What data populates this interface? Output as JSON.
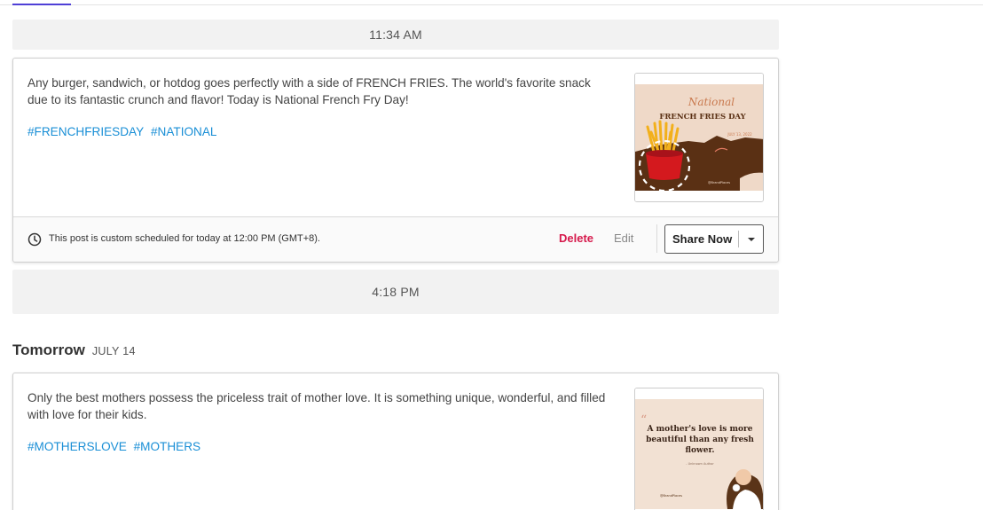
{
  "time_slots": [
    "11:34 AM",
    "4:18 PM"
  ],
  "today_post": {
    "text": "Any burger, sandwich, or hotdog goes perfectly with a side of FRENCH FRIES. The world's favorite snack due to its fantastic crunch and flavor! Today is National French Fry Day!",
    "tags": [
      "#FRENCHFRIESDAY",
      "#NATIONAL"
    ],
    "thumbnail": {
      "script_title": "National",
      "title": "FRENCH FRIES DAY",
      "date": "JULY 13, 2022",
      "handle": "@BrandPlaces",
      "colors": {
        "background": "#efd9c8",
        "band": "#5a3014",
        "box": "#d4191e",
        "fries": "#f2b01c"
      }
    },
    "footer": {
      "schedule_text": "This post is custom scheduled for today at 12:00 PM (GMT+8).",
      "delete_label": "Delete",
      "edit_label": "Edit",
      "share_label": "Share Now"
    }
  },
  "day_header": {
    "name": "Tomorrow",
    "date": "JULY 14"
  },
  "tomorrow_post": {
    "text": "Only the best mothers possess the priceless trait of mother love. It is something unique, wonderful, and filled with love for their kids.",
    "tags": [
      "#MOTHERSLOVE",
      "#MOTHERS"
    ],
    "thumbnail": {
      "quote": [
        "A mother's love is more",
        "beautiful than any fresh",
        "flower."
      ],
      "attribution": "- Unknown Author",
      "handle": "@BrandPlaces",
      "colors": {
        "background": "#f2e1d3",
        "quote_text": "#3a2418",
        "hair": "#5a3418"
      }
    }
  },
  "accent_color": "#4f3fd6",
  "link_color": "#1a8fd6",
  "delete_color": "#d61a4c"
}
